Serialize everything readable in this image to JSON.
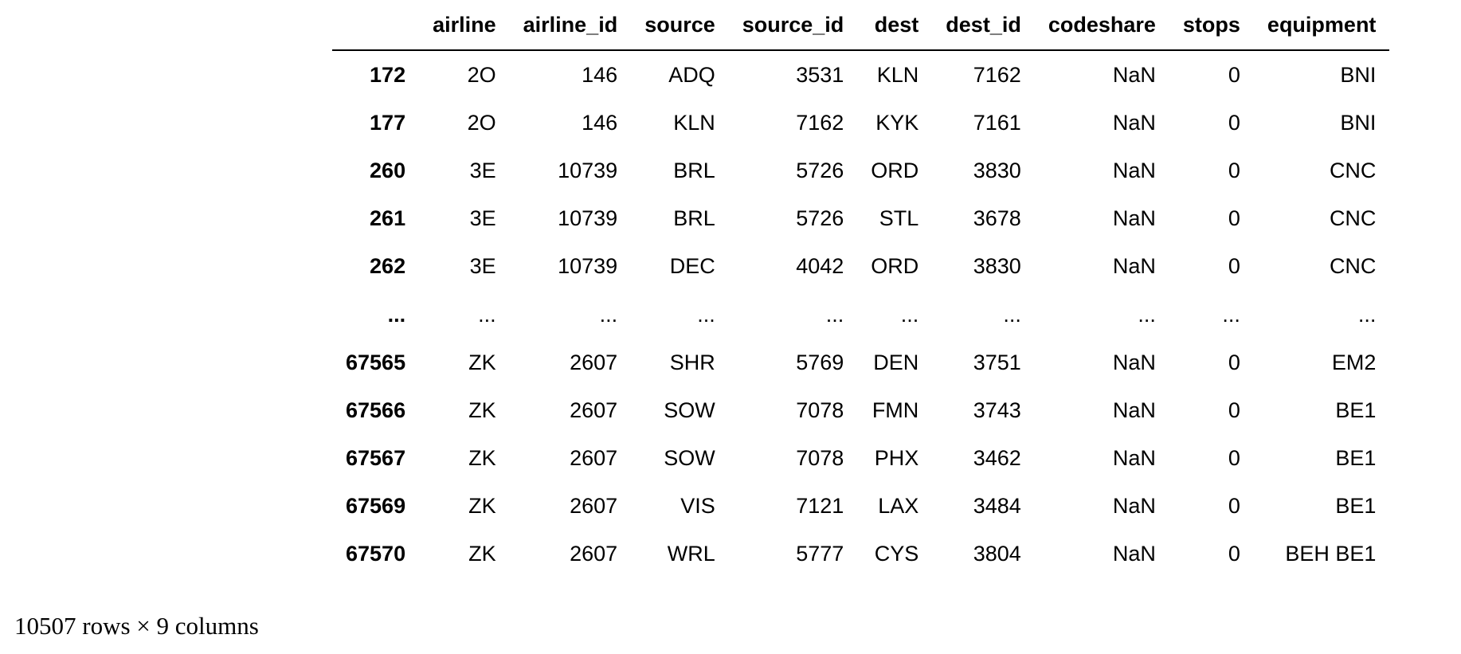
{
  "table": {
    "columns": [
      "airline",
      "airline_id",
      "source",
      "source_id",
      "dest",
      "dest_id",
      "codeshare",
      "stops",
      "equipment"
    ],
    "rows": [
      {
        "index": "172",
        "cells": [
          "2O",
          "146",
          "ADQ",
          "3531",
          "KLN",
          "7162",
          "NaN",
          "0",
          "BNI"
        ]
      },
      {
        "index": "177",
        "cells": [
          "2O",
          "146",
          "KLN",
          "7162",
          "KYK",
          "7161",
          "NaN",
          "0",
          "BNI"
        ]
      },
      {
        "index": "260",
        "cells": [
          "3E",
          "10739",
          "BRL",
          "5726",
          "ORD",
          "3830",
          "NaN",
          "0",
          "CNC"
        ]
      },
      {
        "index": "261",
        "cells": [
          "3E",
          "10739",
          "BRL",
          "5726",
          "STL",
          "3678",
          "NaN",
          "0",
          "CNC"
        ]
      },
      {
        "index": "262",
        "cells": [
          "3E",
          "10739",
          "DEC",
          "4042",
          "ORD",
          "3830",
          "NaN",
          "0",
          "CNC"
        ]
      },
      {
        "index": "...",
        "cells": [
          "...",
          "...",
          "...",
          "...",
          "...",
          "...",
          "...",
          "...",
          "..."
        ]
      },
      {
        "index": "67565",
        "cells": [
          "ZK",
          "2607",
          "SHR",
          "5769",
          "DEN",
          "3751",
          "NaN",
          "0",
          "EM2"
        ]
      },
      {
        "index": "67566",
        "cells": [
          "ZK",
          "2607",
          "SOW",
          "7078",
          "FMN",
          "3743",
          "NaN",
          "0",
          "BE1"
        ]
      },
      {
        "index": "67567",
        "cells": [
          "ZK",
          "2607",
          "SOW",
          "7078",
          "PHX",
          "3462",
          "NaN",
          "0",
          "BE1"
        ]
      },
      {
        "index": "67569",
        "cells": [
          "ZK",
          "2607",
          "VIS",
          "7121",
          "LAX",
          "3484",
          "NaN",
          "0",
          "BE1"
        ]
      },
      {
        "index": "67570",
        "cells": [
          "ZK",
          "2607",
          "WRL",
          "5777",
          "CYS",
          "3804",
          "NaN",
          "0",
          "BEH BE1"
        ]
      }
    ]
  },
  "shape_caption": "10507 rows × 9 columns"
}
